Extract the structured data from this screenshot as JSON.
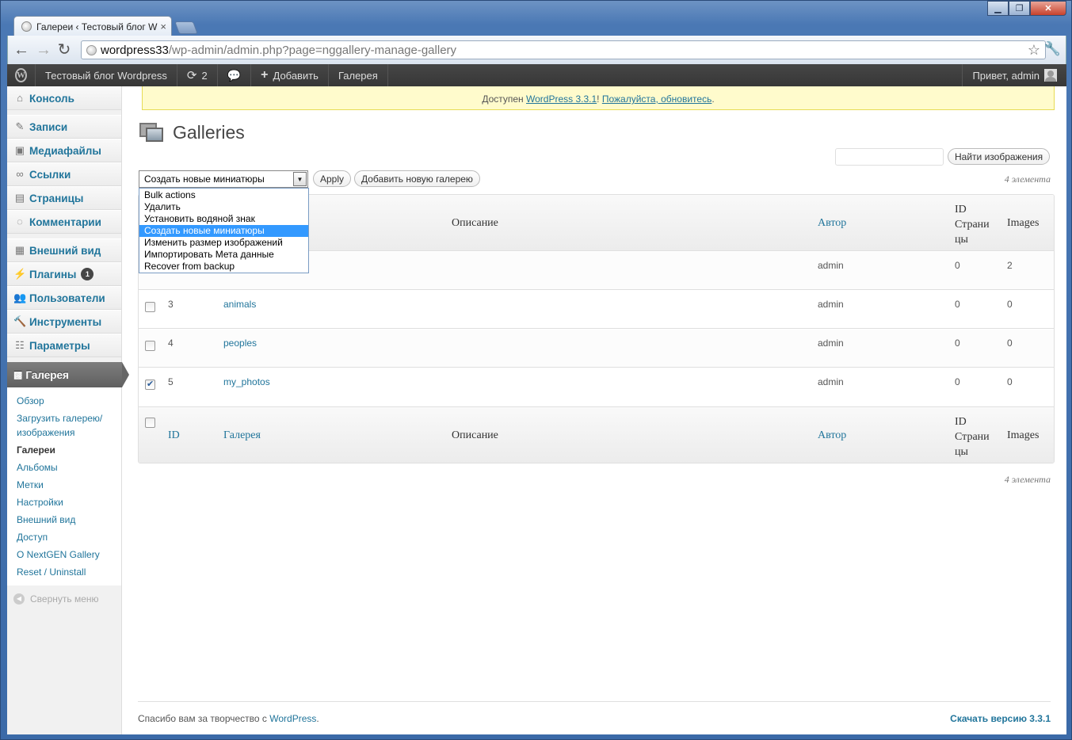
{
  "browser": {
    "tab_title": "Галереи ‹ Тестовый блог W",
    "url_host": "wordpress33",
    "url_path": "/wp-admin/admin.php?page=nggallery-manage-gallery"
  },
  "adminbar": {
    "site_name": "Тестовый блог Wordpress",
    "updates_count": "2",
    "add_new": "Добавить",
    "gallery": "Галерея",
    "greeting": "Привет, admin"
  },
  "sidebar": {
    "items": [
      {
        "label": "Консоль",
        "icon": "home-icon"
      },
      {
        "label": "Записи",
        "icon": "pin-icon"
      },
      {
        "label": "Медиафайлы",
        "icon": "media-icon"
      },
      {
        "label": "Ссылки",
        "icon": "link-icon"
      },
      {
        "label": "Страницы",
        "icon": "page-icon"
      },
      {
        "label": "Комментарии",
        "icon": "comment-icon"
      },
      {
        "label": "Внешний вид",
        "icon": "appearance-icon"
      },
      {
        "label": "Плагины",
        "icon": "plugin-icon",
        "badge": "1"
      },
      {
        "label": "Пользователи",
        "icon": "users-icon"
      },
      {
        "label": "Инструменты",
        "icon": "tools-icon"
      },
      {
        "label": "Параметры",
        "icon": "settings-icon"
      }
    ],
    "current": "Галерея",
    "submenu": [
      "Обзор",
      "Загрузить галерею/ изображения",
      "Галереи",
      "Альбомы",
      "Метки",
      "Настройки",
      "Внешний вид",
      "Доступ",
      "О NextGEN Gallery",
      "Reset / Uninstall"
    ],
    "collapse": "Свернуть меню"
  },
  "notice": {
    "prefix": "Доступен ",
    "link1": "WordPress 3.3.1",
    "sep": "! ",
    "link2": "Пожалуйста, обновитесь",
    "suffix": "."
  },
  "page_title": "Galleries",
  "search_button": "Найти изображения",
  "bulk": {
    "selected": "Создать новые миниатюры",
    "options": [
      "Bulk actions",
      "Удалить",
      "Установить водяной знак",
      "Создать новые миниатюры",
      "Изменить размер изображений",
      "Импортировать Мета данные",
      "Recover from backup"
    ],
    "apply": "Apply",
    "add_gallery": "Добавить новую галерею"
  },
  "count_label": "4 элемента",
  "table": {
    "headers": {
      "id": "ID",
      "gallery": "Галерея",
      "description": "Описание",
      "author": "Автор",
      "page_id": "ID Страни цы",
      "images": "Images"
    },
    "rows": [
      {
        "id": "",
        "name": "",
        "author": "admin",
        "page_id": "0",
        "images": "2",
        "checked": false
      },
      {
        "id": "3",
        "name": "animals",
        "author": "admin",
        "page_id": "0",
        "images": "0",
        "checked": false
      },
      {
        "id": "4",
        "name": "peoples",
        "author": "admin",
        "page_id": "0",
        "images": "0",
        "checked": false
      },
      {
        "id": "5",
        "name": "my_photos",
        "author": "admin",
        "page_id": "0",
        "images": "0",
        "checked": true
      }
    ]
  },
  "footer": {
    "left_text": "Спасибо вам за творчество с ",
    "left_link": "WordPress",
    "left_end": ".",
    "right": "Скачать версию 3.3.1"
  }
}
